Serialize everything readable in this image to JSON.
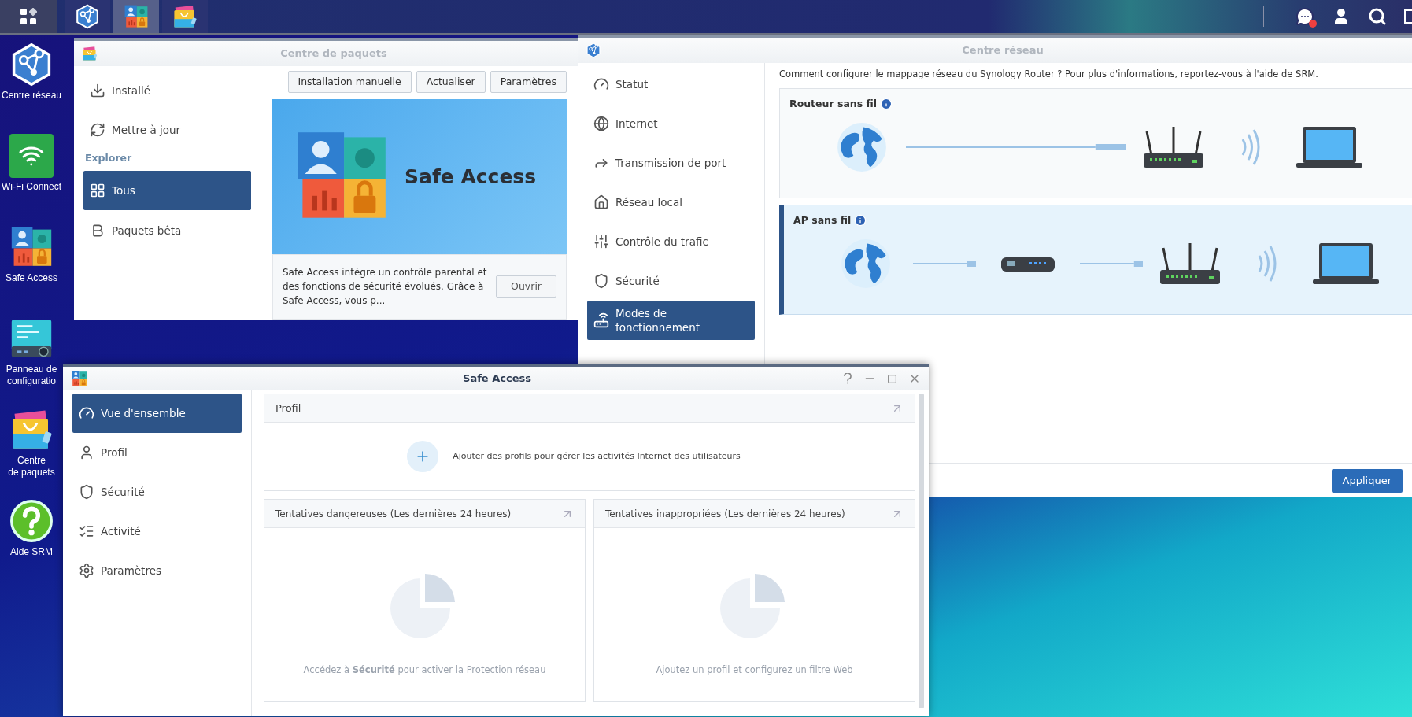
{
  "taskbar": {
    "apps": [
      {
        "kind": "network",
        "selected": false
      },
      {
        "kind": "safe",
        "selected": true
      },
      {
        "kind": "packages",
        "selected": false
      }
    ]
  },
  "desktop_icons": [
    {
      "kind": "network",
      "lines": [
        "Centre réseau"
      ]
    },
    {
      "kind": "wifi",
      "lines": [
        "Wi-Fi Connect"
      ]
    },
    {
      "kind": "safe",
      "lines": [
        "Safe Access"
      ]
    },
    {
      "kind": "panel",
      "lines": [
        "Panneau de",
        "configuratio"
      ]
    },
    {
      "kind": "packages",
      "lines": [
        "Centre",
        "de paquets"
      ]
    },
    {
      "kind": "help",
      "lines": [
        "Aide SRM"
      ]
    }
  ],
  "package_center": {
    "title": "Centre de paquets",
    "sidebar": [
      {
        "kind": "installed",
        "label": "Installé",
        "selected": false
      },
      {
        "kind": "update",
        "label": "Mettre à jour",
        "selected": false
      }
    ],
    "explore": {
      "heading": "Explorer",
      "items": [
        {
          "kind": "all",
          "label": "Tous",
          "selected": true
        },
        {
          "kind": "beta",
          "label": "Paquets bêta",
          "selected": false
        }
      ]
    },
    "toolbar": [
      "Installation manuelle",
      "Actualiser",
      "Paramètres"
    ],
    "featured": {
      "name": "Safe Access",
      "description": "Safe Access intègre un contrôle parental et des fonctions de sécurité évolués. Grâce à Safe Access, vous p...",
      "button": "Ouvrir"
    }
  },
  "network_center": {
    "title": "Centre réseau",
    "sidebar": [
      {
        "kind": "status",
        "label": "Statut",
        "selected": false
      },
      {
        "kind": "internet",
        "label": "Internet",
        "selected": false
      },
      {
        "kind": "port",
        "label": "Transmission de port",
        "selected": false
      },
      {
        "kind": "lan",
        "label": "Réseau local",
        "selected": false
      },
      {
        "kind": "traffic",
        "label": "Contrôle du trafic",
        "selected": false
      },
      {
        "kind": "security",
        "label": "Sécurité",
        "selected": false
      },
      {
        "kind": "modes",
        "label": "Modes de fonctionnement",
        "selected": true
      }
    ],
    "intro": "Comment configurer le mappage réseau du Synology Router ? Pour plus d'informations, reportez-vous à l'aide de SRM.",
    "modes": [
      {
        "kind": "router",
        "title": "Routeur sans fil",
        "selected": false
      },
      {
        "kind": "ap",
        "title": "AP sans fil",
        "selected": true
      }
    ],
    "apply": "Appliquer"
  },
  "safe_access": {
    "title": "Safe Access",
    "sidebar": [
      {
        "kind": "overview",
        "label": "Vue d'ensemble",
        "selected": true
      },
      {
        "kind": "profile",
        "label": "Profil",
        "selected": false
      },
      {
        "kind": "security",
        "label": "Sécurité",
        "selected": false
      },
      {
        "kind": "activity",
        "label": "Activité",
        "selected": false
      },
      {
        "kind": "settings",
        "label": "Paramètres",
        "selected": false
      }
    ],
    "profile_card": {
      "title": "Profil",
      "message": "Ajouter des profils pour gérer les activités Internet des utilisateurs"
    },
    "cards": [
      {
        "title": "Tentatives dangereuses (Les dernières 24 heures)",
        "message": "Accédez à **Sécurité** pour activer la Protection réseau"
      },
      {
        "title": "Tentatives inappropriées (Les dernières 24 heures)",
        "message": "Ajoutez un profil et configurez un filtre Web"
      }
    ]
  }
}
